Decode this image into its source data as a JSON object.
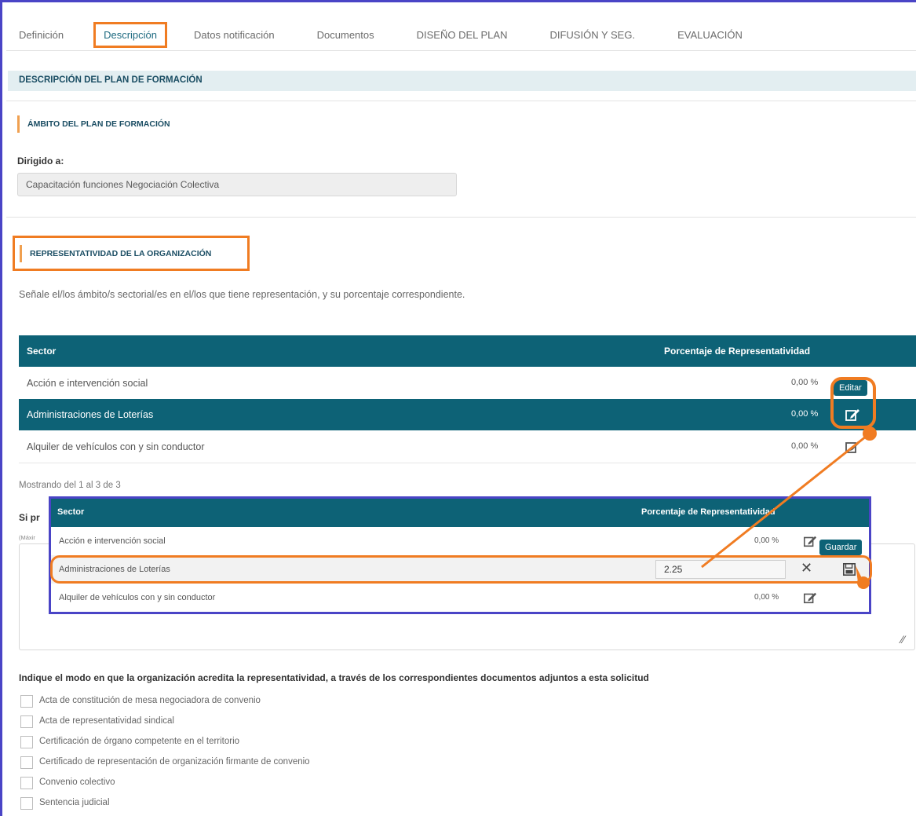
{
  "tabs": [
    {
      "label": "Definición"
    },
    {
      "label": "Descripción",
      "active": true
    },
    {
      "label": "Datos notificación"
    },
    {
      "label": "Documentos"
    },
    {
      "label": "DISEÑO DEL PLAN"
    },
    {
      "label": "DIFUSIÓN Y SEG."
    },
    {
      "label": "EVALUACIÓN"
    }
  ],
  "section_title": "DESCRIPCIÓN DEL PLAN DE FORMACIÓN",
  "ambito": {
    "title": "ÁMBITO DEL PLAN DE FORMACIÓN",
    "dirigido_label": "Dirigido a:",
    "dirigido_value": "Capacitación funciones Negociación Colectiva"
  },
  "representatividad": {
    "title": "REPRESENTATIVIDAD DE LA ORGANIZACIÓN",
    "instructions": "Señale el/los ámbito/s sectorial/es en el/los que tiene representación, y su porcentaje correspondiente.",
    "table": {
      "headers": [
        "Sector",
        "Porcentaje de Representatividad"
      ],
      "rows": [
        {
          "sector": "Acción e intervención social",
          "pct": "0,00 %"
        },
        {
          "sector": "Administraciones de Loterías",
          "pct": "0,00 %"
        },
        {
          "sector": "Alquiler de vehículos con y sin conductor",
          "pct": "0,00 %"
        }
      ]
    },
    "showing": "Mostrando del 1 al 3 de 3",
    "tooltip_edit": "Editar"
  },
  "inset": {
    "headers": [
      "Sector",
      "Porcentaje de Representatividad"
    ],
    "rows": [
      {
        "sector": "Acción e intervención social",
        "pct": "0,00 %"
      },
      {
        "sector": "Administraciones de Loterías",
        "value": "2.25"
      },
      {
        "sector": "Alquiler de vehículos con y sin conductor",
        "pct": "0,00 %"
      }
    ],
    "tooltip_save": "Guardar"
  },
  "hidden_question": {
    "label": "Si pr",
    "hint": "(Máxir"
  },
  "acreditacion": {
    "title": "Indique el modo en que la organización acredita la representatividad, a través de los correspondientes documentos adjuntos a esta solicitud",
    "options": [
      {
        "label": "Acta de constitución de mesa negociadora de convenio"
      },
      {
        "label": "Acta de representatividad sindical"
      },
      {
        "label": "Certificación de órgano competente en el territorio"
      },
      {
        "label": "Certificado de representación de organización firmante de convenio"
      },
      {
        "label": "Convenio colectivo"
      },
      {
        "label": "Sentencia judicial"
      }
    ]
  },
  "colors": {
    "accent": "#0d6276",
    "highlight": "#f07c22",
    "frame": "#4a44c6"
  }
}
